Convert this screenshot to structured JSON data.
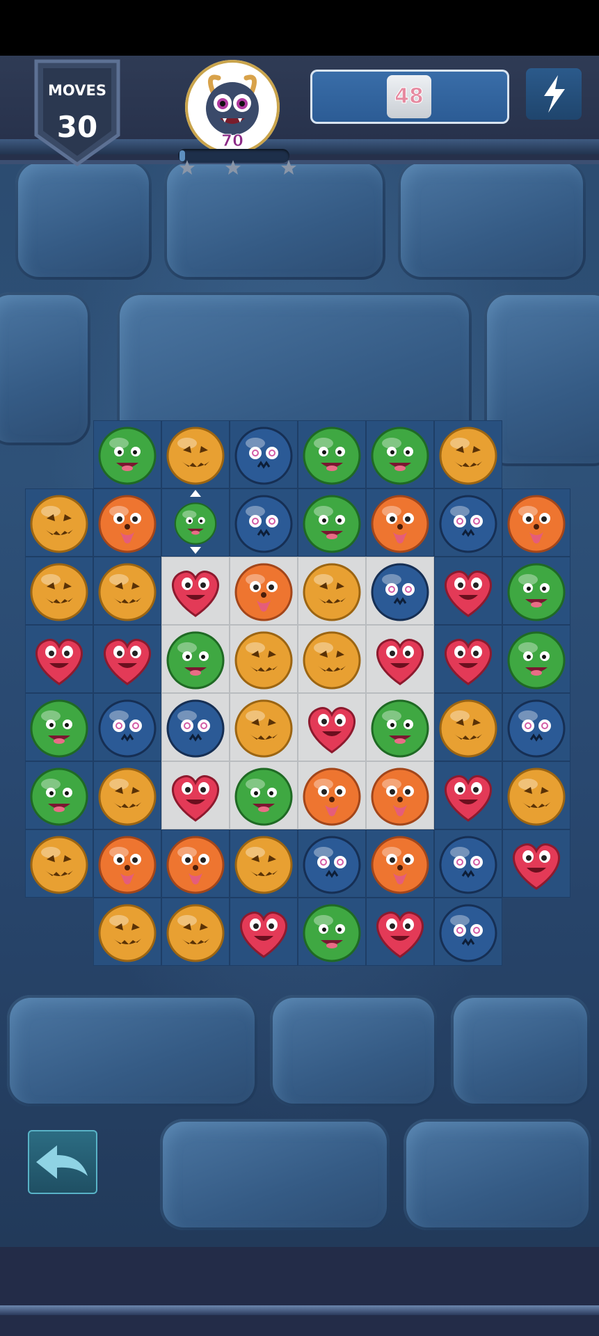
{
  "hud": {
    "moves_label": "MOVES",
    "moves_value": "30",
    "avatar_count": "70",
    "target_progress": 0.05,
    "score_value": "48"
  },
  "colors": {
    "green": "#3fa842",
    "orange_pumpkin": "#e8a032",
    "blue": "#2b5a96",
    "orange_face": "#ee7530",
    "heart": "#e33a57"
  },
  "board": {
    "rows": [
      [
        "",
        "green",
        "pumpkin",
        "blue",
        "green",
        "green",
        "pumpkin",
        ""
      ],
      [
        "pumpkin",
        "orange",
        "green",
        "blue",
        "green",
        "orange",
        "blue",
        "orange"
      ],
      [
        "pumpkin",
        "pumpkin",
        "heart",
        "orange",
        "pumpkin",
        "blue",
        "heart",
        "green"
      ],
      [
        "heart",
        "heart",
        "green",
        "pumpkin",
        "pumpkin",
        "heart",
        "heart",
        "green"
      ],
      [
        "green",
        "blue",
        "blue",
        "pumpkin",
        "heart",
        "green",
        "pumpkin",
        "blue"
      ],
      [
        "green",
        "pumpkin",
        "heart",
        "green",
        "orange",
        "orange",
        "heart",
        "pumpkin"
      ],
      [
        "pumpkin",
        "orange",
        "orange",
        "pumpkin",
        "blue",
        "orange",
        "blue",
        "heart"
      ],
      [
        "",
        "pumpkin",
        "pumpkin",
        "heart",
        "green",
        "heart",
        "blue",
        ""
      ]
    ],
    "light_tiles": [
      [
        2,
        2
      ],
      [
        2,
        3
      ],
      [
        2,
        4
      ],
      [
        2,
        5
      ],
      [
        3,
        2
      ],
      [
        3,
        3
      ],
      [
        3,
        4
      ],
      [
        3,
        5
      ],
      [
        4,
        2
      ],
      [
        4,
        3
      ],
      [
        4,
        4
      ],
      [
        4,
        5
      ],
      [
        5,
        2
      ],
      [
        5,
        3
      ],
      [
        5,
        4
      ],
      [
        5,
        5
      ]
    ],
    "selected": [
      1,
      2
    ]
  },
  "icons": {
    "moves": "shield-icon",
    "avatar": "monster-avatar-icon",
    "power": "lightning-bolt-icon",
    "undo": "undo-arrow-icon",
    "star": "star-icon"
  }
}
